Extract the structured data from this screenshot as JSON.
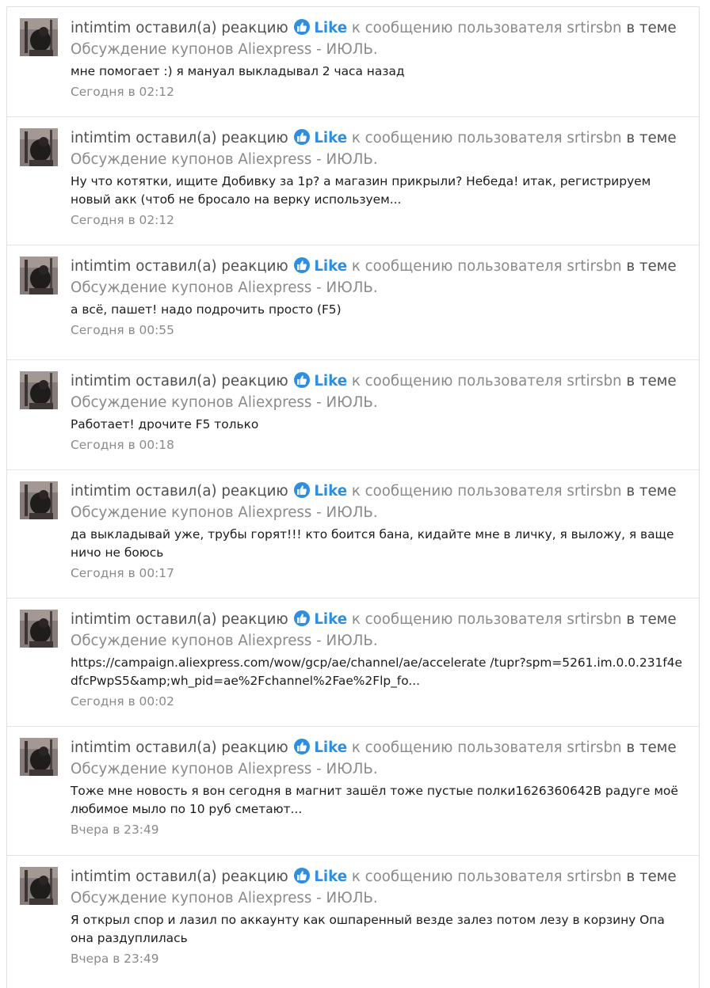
{
  "items": [
    {
      "user": "intimtim",
      "verb": "оставил(а) реакцию",
      "reaction": "Like",
      "preposition": "к сообщению пользователя",
      "target_user": "srtirsbn",
      "context": "в теме",
      "topic": "Обсуждение купонов Aliexpress - ИЮЛЬ.",
      "snippet": "мне помогает :) я мануал выкладывал 2 часа назад",
      "time": "Сегодня в 02:12"
    },
    {
      "user": "intimtim",
      "verb": "оставил(а) реакцию",
      "reaction": "Like",
      "preposition": "к сообщению пользователя",
      "target_user": "srtirsbn",
      "context": "в теме",
      "topic": "Обсуждение купонов Aliexpress - ИЮЛЬ.",
      "snippet": "Ну что котятки, ищите Добивку за 1р? а магазин прикрыли? Небеда! итак, регистрируем новый акк (чтоб не бросало на верку используем...",
      "time": "Сегодня в 02:12"
    },
    {
      "user": "intimtim",
      "verb": "оставил(а) реакцию",
      "reaction": "Like",
      "preposition": "к сообщению пользователя",
      "target_user": "srtirsbn",
      "context": "в теме",
      "topic": "Обсуждение купонов Aliexpress - ИЮЛЬ.",
      "snippet": "а всё, пашет! надо подрочить просто (F5)",
      "time": "Сегодня в 00:55"
    },
    {
      "user": "intimtim",
      "verb": "оставил(а) реакцию",
      "reaction": "Like",
      "preposition": "к сообщению пользователя",
      "target_user": "srtirsbn",
      "context": "в теме",
      "topic": "Обсуждение купонов Aliexpress - ИЮЛЬ.",
      "snippet": "Работает! дрочите F5 только",
      "time": "Сегодня в 00:18"
    },
    {
      "user": "intimtim",
      "verb": "оставил(а) реакцию",
      "reaction": "Like",
      "preposition": "к сообщению пользователя",
      "target_user": "srtirsbn",
      "context": "в теме",
      "topic": "Обсуждение купонов Aliexpress - ИЮЛЬ.",
      "snippet": "да выкладывай уже, трубы горят!!! кто боится бана, кидайте мне в личку, я выложу, я ваще ничо не боюсь",
      "time": "Сегодня в 00:17"
    },
    {
      "user": "intimtim",
      "verb": "оставил(а) реакцию",
      "reaction": "Like",
      "preposition": "к сообщению пользователя",
      "target_user": "srtirsbn",
      "context": "в теме",
      "topic": "Обсуждение купонов Aliexpress - ИЮЛЬ.",
      "snippet": "https://campaign.aliexpress.com/wow/gcp/ae/channel/ae/accelerate /tupr?spm=5261.im.0.0.231f4edfcPwpS5&amp;wh_pid=ae%2Fchannel%2Fae%2Flp_fo...",
      "time": "Сегодня в 00:02"
    },
    {
      "user": "intimtim",
      "verb": "оставил(а) реакцию",
      "reaction": "Like",
      "preposition": "к сообщению пользователя",
      "target_user": "srtirsbn",
      "context": "в теме",
      "topic": "Обсуждение купонов Aliexpress - ИЮЛЬ.",
      "snippet": "Тоже мне новость я вон сегодня в магнит зашёл тоже пустые полки1626360642В радуге моё любимое мыло по 10 руб сметают...",
      "time": "Вчера в 23:49"
    },
    {
      "user": "intimtim",
      "verb": "оставил(а) реакцию",
      "reaction": "Like",
      "preposition": "к сообщению пользователя",
      "target_user": "srtirsbn",
      "context": "в теме",
      "topic": "Обсуждение купонов Aliexpress - ИЮЛЬ.",
      "snippet": "Я открыл спор и лазил по аккаунту как ошпаренный везде залез потом лезу в корзину Опа она раздуплилась",
      "time": "Вчера в 23:49"
    }
  ],
  "colors": {
    "link_blue": "#2f8ee0",
    "muted_gray": "#8a8a8a",
    "text_dark": "#1c1c1c",
    "border": "#e3e3e3"
  },
  "icons": {
    "reaction": "thumbs-up-icon"
  }
}
